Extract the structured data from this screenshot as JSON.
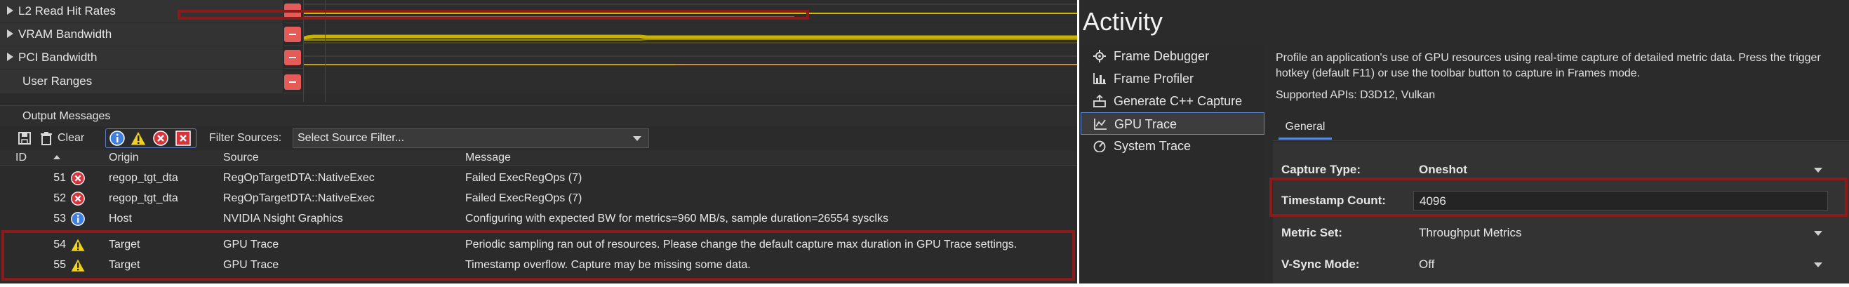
{
  "timeline": {
    "rows": [
      {
        "label": "L2 Read Hit Rates",
        "expandable": true
      },
      {
        "label": "VRAM Bandwidth",
        "expandable": true
      },
      {
        "label": "PCI Bandwidth",
        "expandable": true
      },
      {
        "label": "User Ranges",
        "expandable": false
      }
    ]
  },
  "output": {
    "title": "Output Messages",
    "clear_label": "Clear",
    "filter_sources_label": "Filter Sources:",
    "filter_select_value": "Select Source Filter...",
    "columns": {
      "id": "ID",
      "origin": "Origin",
      "source": "Source",
      "message": "Message"
    },
    "rows": [
      {
        "id": "51",
        "type": "error",
        "origin": "regop_tgt_dta",
        "source": "RegOpTargetDTA::NativeExec",
        "message": "Failed ExecRegOps (7)"
      },
      {
        "id": "52",
        "type": "error",
        "origin": "regop_tgt_dta",
        "source": "RegOpTargetDTA::NativeExec",
        "message": "Failed ExecRegOps (7)"
      },
      {
        "id": "53",
        "type": "info",
        "origin": "Host",
        "source": "NVIDIA Nsight Graphics",
        "message": "Configuring with expected BW for metrics=960 MB/s, sample duration=26554 sysclks"
      },
      {
        "id": "54",
        "type": "warning",
        "origin": "Target",
        "source": "GPU Trace",
        "message": "Periodic sampling ran out of resources. Please change the default capture max duration in GPU Trace settings."
      },
      {
        "id": "55",
        "type": "warning",
        "origin": "Target",
        "source": "GPU Trace",
        "message": "Timestamp overflow. Capture may be missing some data."
      }
    ]
  },
  "activity": {
    "title": "Activity",
    "items": [
      {
        "label": "Frame Debugger",
        "icon": "gear-icon"
      },
      {
        "label": "Frame Profiler",
        "icon": "bar-chart-icon"
      },
      {
        "label": "Generate C++ Capture",
        "icon": "cpp-capture-icon"
      },
      {
        "label": "GPU Trace",
        "icon": "trace-chart-icon",
        "selected": true
      },
      {
        "label": "System Trace",
        "icon": "gauge-icon"
      }
    ],
    "description": "Profile an application's use of GPU resources using real-time capture of detailed metric data. Press the trigger hotkey (default F11) or use the toolbar button to capture in Frames mode.",
    "supported_apis": "Supported APIs: D3D12, Vulkan",
    "tab": "General",
    "settings": [
      {
        "label": "Capture Type:",
        "value": "Oneshot",
        "kind": "dropdown"
      },
      {
        "label": "Timestamp Count:",
        "value": "4096",
        "kind": "input"
      },
      {
        "label": "Metric Set:",
        "value": "Throughput Metrics",
        "kind": "dropdown"
      },
      {
        "label": "V-Sync Mode:",
        "value": "Off",
        "kind": "dropdown"
      }
    ]
  },
  "colors": {
    "highlight": "#8b1a1a",
    "accent": "#5a8ad9",
    "error": "#e45b57",
    "warning": "#f2d21b",
    "info": "#3f7fe0",
    "trace_yellow": "#c8b400"
  }
}
